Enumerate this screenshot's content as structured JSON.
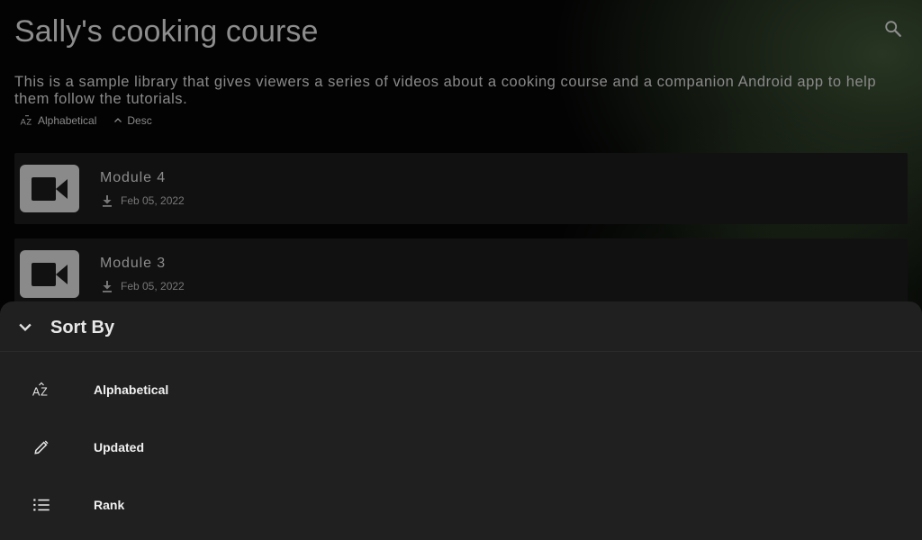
{
  "header": {
    "title": "Sally's cooking course",
    "search_icon": "search-icon"
  },
  "description": "This is a sample library that gives viewers a series of videos about a cooking course and a companion Android app to help them follow the tutorials.",
  "sort_chips": {
    "sort_field": "Alphabetical",
    "sort_order": "Desc"
  },
  "modules": [
    {
      "title": "Module 4",
      "date": "Feb 05, 2022",
      "icon": "video-camera-icon"
    },
    {
      "title": "Module 3",
      "date": "Feb 05, 2022",
      "icon": "video-camera-icon"
    }
  ],
  "sort_sheet": {
    "title": "Sort By",
    "options": [
      {
        "label": "Alphabetical",
        "icon": "alphabetical-sort-icon"
      },
      {
        "label": "Updated",
        "icon": "pencil-icon"
      },
      {
        "label": "Rank",
        "icon": "numbered-list-icon"
      }
    ]
  },
  "colors": {
    "background": "#030303",
    "card": "#111111",
    "sheet": "#202020",
    "muted_text": "#8d8d8d"
  }
}
